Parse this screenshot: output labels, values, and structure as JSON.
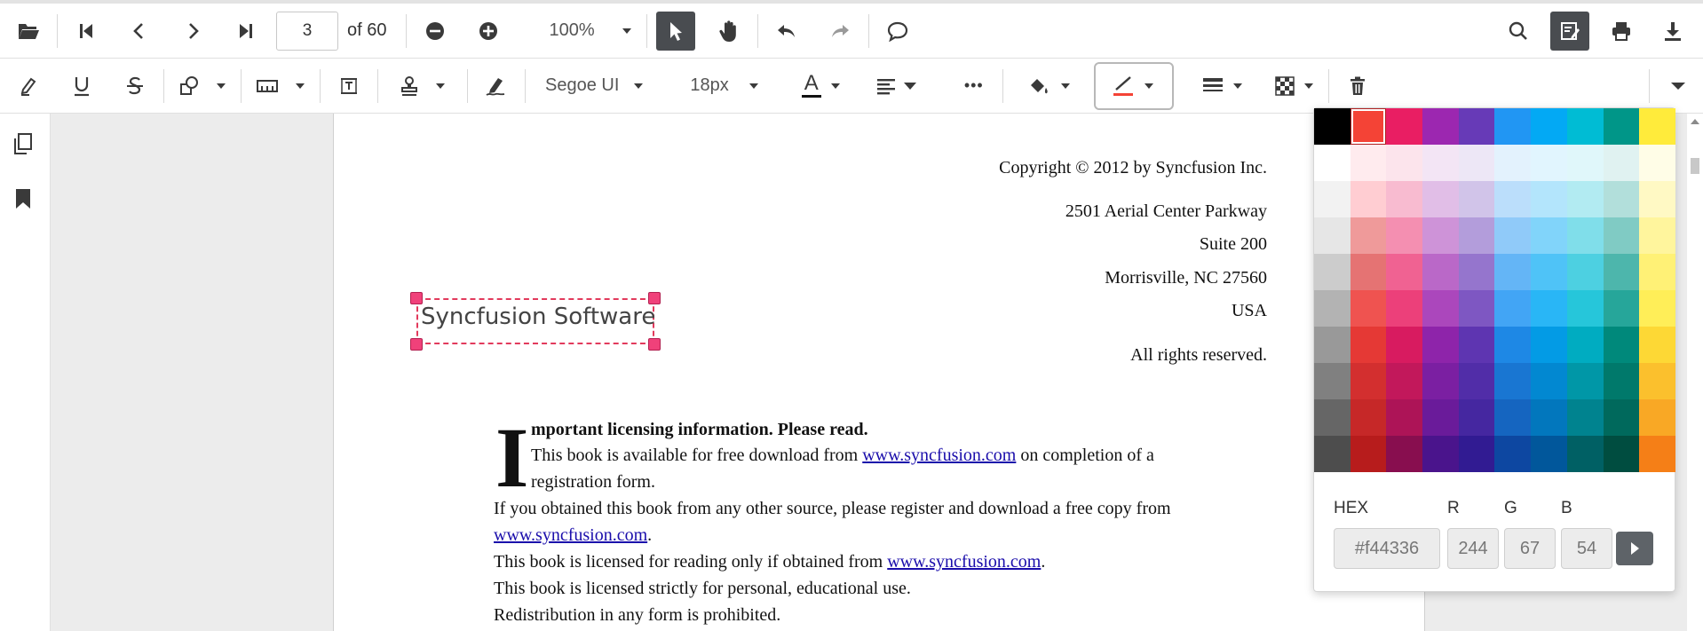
{
  "toolbar_main": {
    "page_number": "3",
    "page_total_label": "of 60",
    "zoom_label": "100%",
    "icons": [
      "folder-open-icon",
      "first-page-icon",
      "previous-page-icon",
      "next-page-icon",
      "last-page-icon",
      "zoom-out-icon",
      "zoom-in-icon",
      "select-cursor-icon",
      "pan-hand-icon",
      "undo-icon",
      "redo-icon",
      "comment-icon",
      "search-icon",
      "annotation-edit-icon",
      "print-icon",
      "download-icon"
    ]
  },
  "toolbar_annotation": {
    "font_family": "Segoe UI",
    "font_size": "18px",
    "font_color_glyph": "A",
    "more_glyph": "•••",
    "icons": [
      "highlight-icon",
      "underline-icon",
      "strikethrough-icon",
      "shapes-icon",
      "measure-icon",
      "free-text-icon",
      "stamp-icon",
      "signature-icon",
      "fill-color-icon",
      "stroke-color-icon",
      "thickness-icon",
      "opacity-icon",
      "delete-icon",
      "collapse-icon"
    ]
  },
  "sidebar": {
    "icons": [
      "page-thumbnails-icon",
      "bookmark-icon"
    ]
  },
  "document": {
    "copyright": "Copyright © 2012 by Syncfusion Inc.",
    "address1": "2501 Aerial Center Parkway",
    "address2": "Suite 200",
    "address3": "Morrisville, NC 27560",
    "address4": "USA",
    "rights": "All rights reserved.",
    "dropcap": "I",
    "heading": "mportant licensing information. Please read.",
    "p1_pre": "This book is available for free download from ",
    "p1_link": "www.syncfusion.com",
    "p1_post": " on completion of a",
    "p1_line2": "registration form.",
    "p2": "If you obtained this book from any other source, please register and download a free copy from",
    "p2_link": "www.syncfusion.com",
    "p2_post": ".",
    "p3_pre": "This book is licensed for reading only if obtained from ",
    "p3_link": "www.syncfusion.com",
    "p3_post": ".",
    "p4": "This book is licensed strictly for personal, educational use.",
    "p5": "Redistribution in any form is prohibited."
  },
  "annotation": {
    "text": "Syncfusion Software",
    "border_color": "#e23a5c"
  },
  "color_picker": {
    "hex_label": "HEX",
    "r_label": "R",
    "g_label": "G",
    "b_label": "B",
    "hex_value": "#f44336",
    "r_value": "244",
    "g_value": "67",
    "b_value": "54",
    "selected_index": 1,
    "palette": [
      "#000000",
      "#f44336",
      "#e91e63",
      "#9c27b0",
      "#673ab7",
      "#2196f3",
      "#03a9f4",
      "#00bcd4",
      "#009688",
      "#ffeb3b",
      "#ffffff",
      "#ffebee",
      "#fce4ec",
      "#f3e5f5",
      "#ede7f6",
      "#e3f2fd",
      "#e1f5fe",
      "#e0f7fa",
      "#e0f2f1",
      "#fffde7",
      "#f2f2f2",
      "#ffcdd2",
      "#f8bbd0",
      "#e1bee7",
      "#d1c4e9",
      "#bbdefb",
      "#b3e5fc",
      "#b2ebf2",
      "#b2dfdb",
      "#fff9c4",
      "#e6e6e6",
      "#ef9a9a",
      "#f48fb1",
      "#ce93d8",
      "#b39ddb",
      "#90caf9",
      "#81d4fa",
      "#80deea",
      "#80cbc4",
      "#fff59d",
      "#cccccc",
      "#e57373",
      "#f06292",
      "#ba68c8",
      "#9575cd",
      "#64b5f6",
      "#4fc3f7",
      "#4dd0e1",
      "#4db6ac",
      "#fff176",
      "#b3b3b3",
      "#ef5350",
      "#ec407a",
      "#ab47bc",
      "#7e57c2",
      "#42a5f5",
      "#29b6f6",
      "#26c6da",
      "#26a69a",
      "#ffee58",
      "#999999",
      "#e53935",
      "#d81b60",
      "#8e24aa",
      "#5e35b1",
      "#1e88e5",
      "#039be5",
      "#00acc1",
      "#00897b",
      "#fdd835",
      "#808080",
      "#d32f2f",
      "#c2185b",
      "#7b1fa2",
      "#512da8",
      "#1976d2",
      "#0288d1",
      "#0097a7",
      "#00796b",
      "#fbc02d",
      "#666666",
      "#c62828",
      "#ad1457",
      "#6a1b9a",
      "#4527a0",
      "#1565c0",
      "#0277bd",
      "#00838f",
      "#00695c",
      "#f9a825",
      "#4d4d4d",
      "#b71c1c",
      "#880e4f",
      "#4a148c",
      "#311b92",
      "#0d47a1",
      "#01579b",
      "#006064",
      "#004d40",
      "#f57f17"
    ]
  },
  "colors": {
    "accent_dark": "#494c50",
    "link": "#1a0dab",
    "font_color_underline": "#111111",
    "stroke_color_underline": "#f44336"
  }
}
